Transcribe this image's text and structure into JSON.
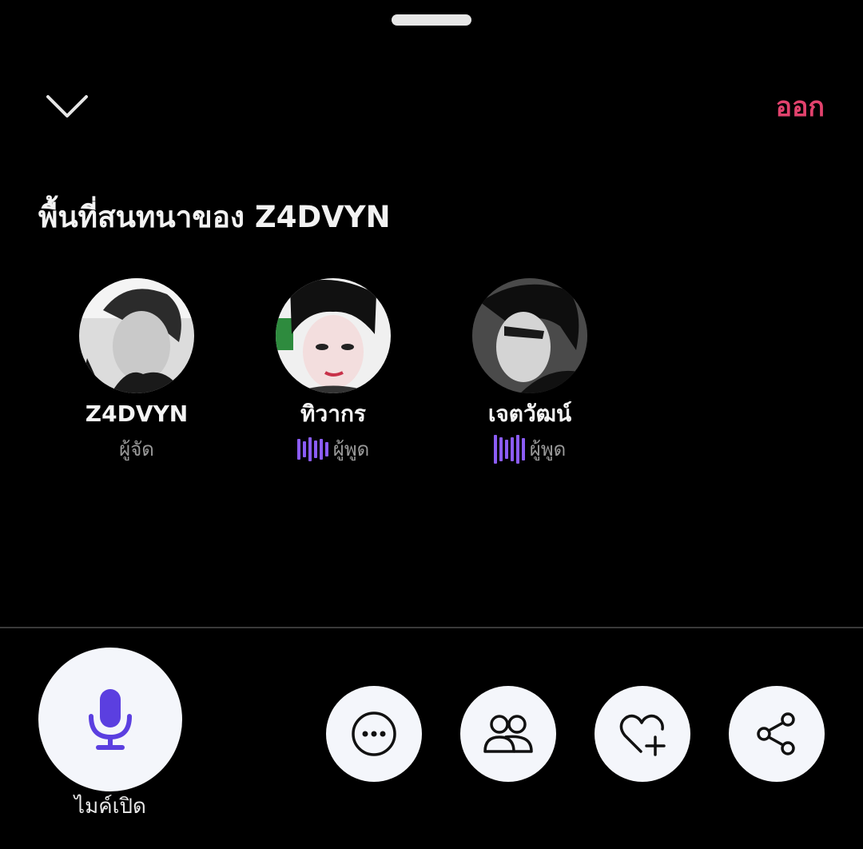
{
  "header": {
    "collapse_icon": "chevron-down-icon",
    "leave_label": "ออก",
    "leave_color": "#e2426d"
  },
  "space": {
    "title": "พื้นที่สนทนาของ Z4DVYN"
  },
  "participants": [
    {
      "name": "Z4DVYN",
      "role": "ผู้จัด",
      "speaking": false
    },
    {
      "name": "ทิวากร",
      "role": "ผู้พูด",
      "speaking": true
    },
    {
      "name": "เจตวัฒน์",
      "role": "ผู้พูด",
      "speaking": true
    }
  ],
  "controls": {
    "mic_label": "ไมค์เปิด",
    "mic_icon": "microphone-icon",
    "mic_color": "#5b3fe0",
    "more_icon": "more-options-icon",
    "people_icon": "people-icon",
    "heart_add_icon": "heart-add-icon",
    "share_icon": "share-icon",
    "speaking_color": "#8b5cf6"
  }
}
